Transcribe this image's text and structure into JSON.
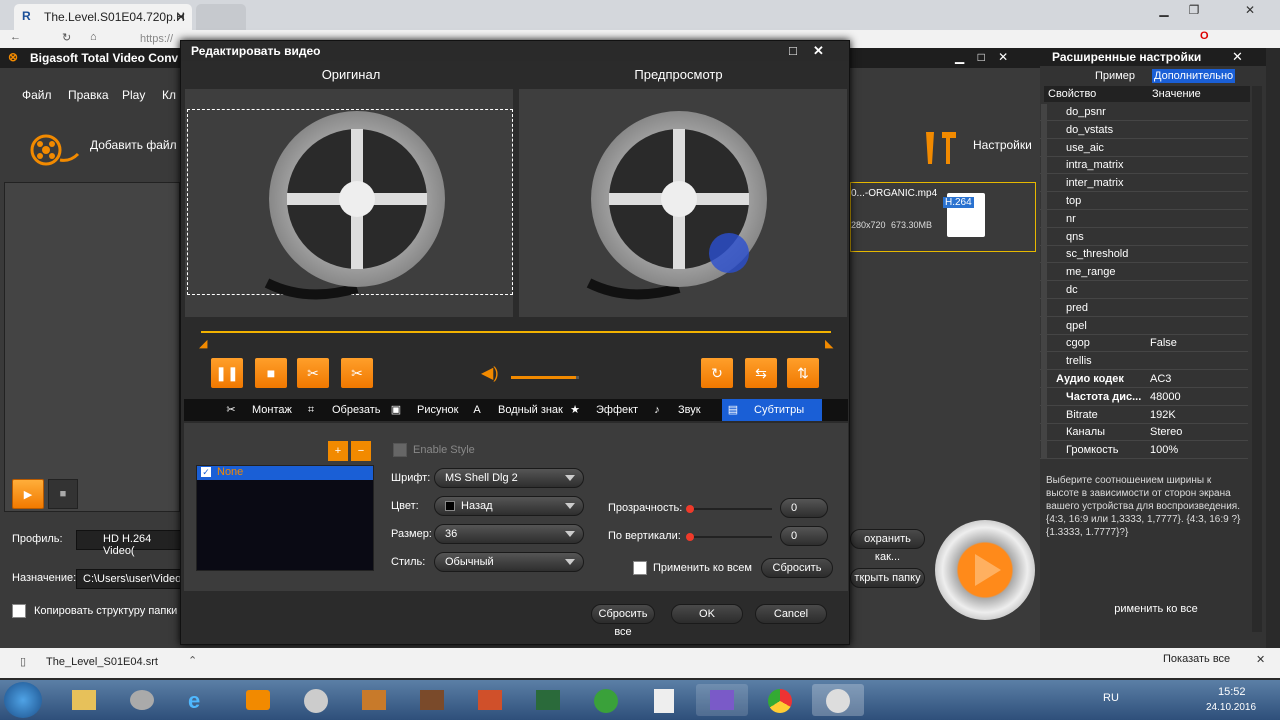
{
  "browser": {
    "tab_title": "The.Level.S01E04.720p.H",
    "address": "https://"
  },
  "app": {
    "title": "Bigasoft Total Video Conv",
    "menu": [
      "Файл",
      "Правка",
      "Play",
      "Кл"
    ],
    "add_file": "Добавить файл",
    "settings": "Настройки",
    "profile_label": "Профиль:",
    "profile_value": "HD H.264 Video(",
    "dest_label": "Назначение:",
    "dest_value": "C:\\Users\\user\\Videos",
    "copy_structure": "Копировать структуру папки",
    "save_as": "охранить как...",
    "open_folder": "ткрыть папку",
    "file_name": "0...-ORGANIC.mp4",
    "file_res": "280x720",
    "file_size": "673.30MB",
    "codec_badge": "H.264"
  },
  "dialog": {
    "title": "Редактировать видео",
    "original": "Оригинал",
    "preview": "Предпросмотр",
    "tabs": [
      "Монтаж",
      "Обрезать",
      "Рисунок",
      "Водный знак",
      "Эффект",
      "Звук",
      "Субтитры"
    ],
    "volume_level": 0.95,
    "progress": 1.0,
    "subs": {
      "list_item": "None",
      "enable_style": "Enable Style",
      "font_label": "Шрифт:",
      "font_value": "MS Shell Dlg 2",
      "color_label": "Цвет:",
      "color_value": "Назад",
      "size_label": "Размер:",
      "size_value": "36",
      "style_label": "Стиль:",
      "style_value": "Обычный",
      "transparency_label": "Прозрачность:",
      "transparency_value": "0",
      "vertical_label": "По вертикали:",
      "vertical_value": "0",
      "apply_all": "Применить ко всем",
      "reset": "Сбросить"
    },
    "reset_all": "Сбросить все",
    "ok": "OK",
    "cancel": "Cancel"
  },
  "advanced": {
    "title": "Расширенные настройки",
    "tab_example": "Пример",
    "tab_additional": "Дополнительно",
    "col_prop": "Свойство",
    "col_value": "Значение",
    "rows": [
      [
        "do_psnr",
        ""
      ],
      [
        "do_vstats",
        ""
      ],
      [
        "use_aic",
        ""
      ],
      [
        "intra_matrix",
        ""
      ],
      [
        "inter_matrix",
        ""
      ],
      [
        "top",
        ""
      ],
      [
        "nr",
        ""
      ],
      [
        "qns",
        ""
      ],
      [
        "sc_threshold",
        ""
      ],
      [
        "me_range",
        ""
      ],
      [
        "dc",
        ""
      ],
      [
        "pred",
        ""
      ],
      [
        "qpel",
        ""
      ],
      [
        "cgop",
        "False"
      ],
      [
        "trellis",
        ""
      ]
    ],
    "audio_header": "Аудио кодек",
    "audio_codec": "AC3",
    "audio_rows": [
      [
        "Частота дис...",
        "48000"
      ],
      [
        "Bitrate",
        "192K"
      ],
      [
        "Каналы",
        "Stereo"
      ],
      [
        "Громкость",
        "100%"
      ]
    ],
    "description": "Выберите соотношением ширины к высоте в зависимости от сторон экрана вашего устройства для воспроизведения. {4:3, 16:9 или 1,3333, 1,7777}. {4:3, 16:9 ?} {1.3333, 1.7777}?}",
    "apply_all": "рименить ко все"
  },
  "download": {
    "file": "The_Level_S01E04.srt",
    "show_all": "Показать все"
  },
  "tray": {
    "lang": "RU",
    "time": "15:52",
    "date": "24.10.2016"
  },
  "colors": {
    "accent": "#f28a00",
    "selection": "#1a5fd6"
  }
}
